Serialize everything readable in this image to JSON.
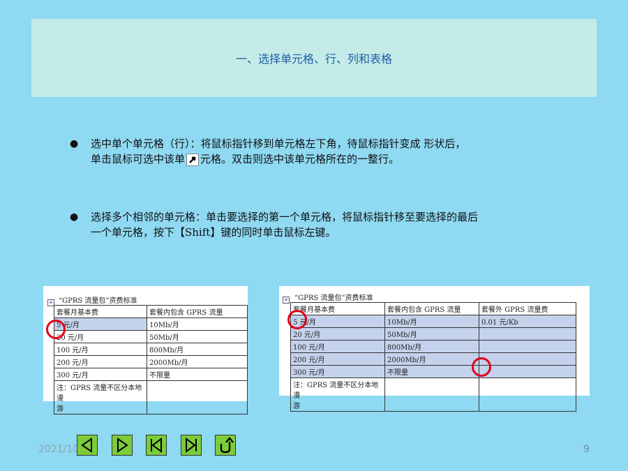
{
  "title": "一、选择单元格、行、列和表格",
  "bullets": [
    {
      "line1": "选中单个单元格（行）：将鼠标指针移到单元格左下角，待鼠标指针变成  形状后，",
      "line2a": "单击鼠标可选中该单",
      "line2b": "元格。双击则选中该单元格所在的一整行。"
    },
    {
      "line1": "选择多个相邻的单元格：单击要选择的第一个单元格，将鼠标指针移至要选择的最后",
      "line2": "一个单元格，按下【Shift】键的同时单击鼠标左键。"
    }
  ],
  "bullet_symbol": "●",
  "shot1": {
    "caption": "“GPRS 流量包”资费标准",
    "headers": [
      "套餐月基本费",
      "套餐内包含 GPRS 流量"
    ],
    "rows": [
      [
        "5 元/月",
        "10Mb/月"
      ],
      [
        "20 元/月",
        "50Mb/月"
      ],
      [
        "100 元/月",
        "800Mb/月"
      ],
      [
        "200 元/月",
        "2000Mb/月"
      ],
      [
        "300 元/月",
        "不限量"
      ]
    ],
    "note_a": "注：GPRS 流量不区分本地漫",
    "note_b": "游"
  },
  "shot2": {
    "caption": "“GPRS 流量包”资费标准",
    "headers": [
      "套餐月基本费",
      "套餐内包含 GPRS 流量",
      "套餐外 GPRS 流量费"
    ],
    "rows": [
      [
        "5 元/月",
        "10Mb/月",
        "0.01 元/Kb"
      ],
      [
        "20 元/月",
        "50Mb/月",
        ""
      ],
      [
        "100 元/月",
        "800Mb/月",
        ""
      ],
      [
        "200 元/月",
        "2000Mb/月",
        ""
      ],
      [
        "300 元/月",
        "不限量",
        ""
      ]
    ],
    "note_a": "注：GPRS 流量不区分本地漫",
    "note_b": "游"
  },
  "footer": {
    "date": "2021/10/10",
    "page": "9"
  },
  "colors": {
    "background": "#8fd9f2",
    "title_box": "#c4ebe8",
    "nav_button": "#7ccc3a",
    "circle": "#e0001a"
  },
  "nav_icons": [
    "back-arrow-icon",
    "play-icon",
    "first-slide-icon",
    "last-slide-icon",
    "return-icon"
  ]
}
